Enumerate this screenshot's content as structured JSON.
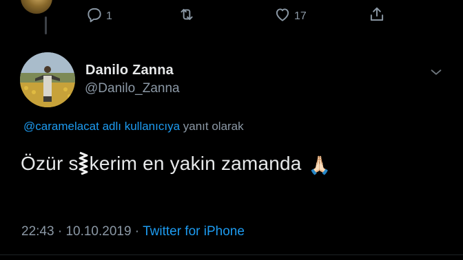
{
  "previous_tweet": {
    "actions": {
      "reply_count": "1",
      "retweet_count": "",
      "like_count": "17",
      "icons": [
        "reply-icon",
        "retweet-icon",
        "like-icon",
        "share-icon"
      ]
    }
  },
  "tweet": {
    "display_name": "Danilo Zanna",
    "handle": "@Danilo_Zanna",
    "reply_to_mention": "@caramelacat adlı kullanıcıya",
    "reply_to_suffix": " yanıt olarak",
    "text_before": "Özür s",
    "text_after": "kerim en yakin zamanda",
    "emoji": "🙏🏻",
    "time": "22:43",
    "separator": " · ",
    "date": "10.10.2019",
    "source": "Twitter for iPhone"
  },
  "colors": {
    "background": "#000000",
    "primary_text": "#e7e9ea",
    "secondary_text": "#8b98a5",
    "accent": "#1d9bf0"
  }
}
